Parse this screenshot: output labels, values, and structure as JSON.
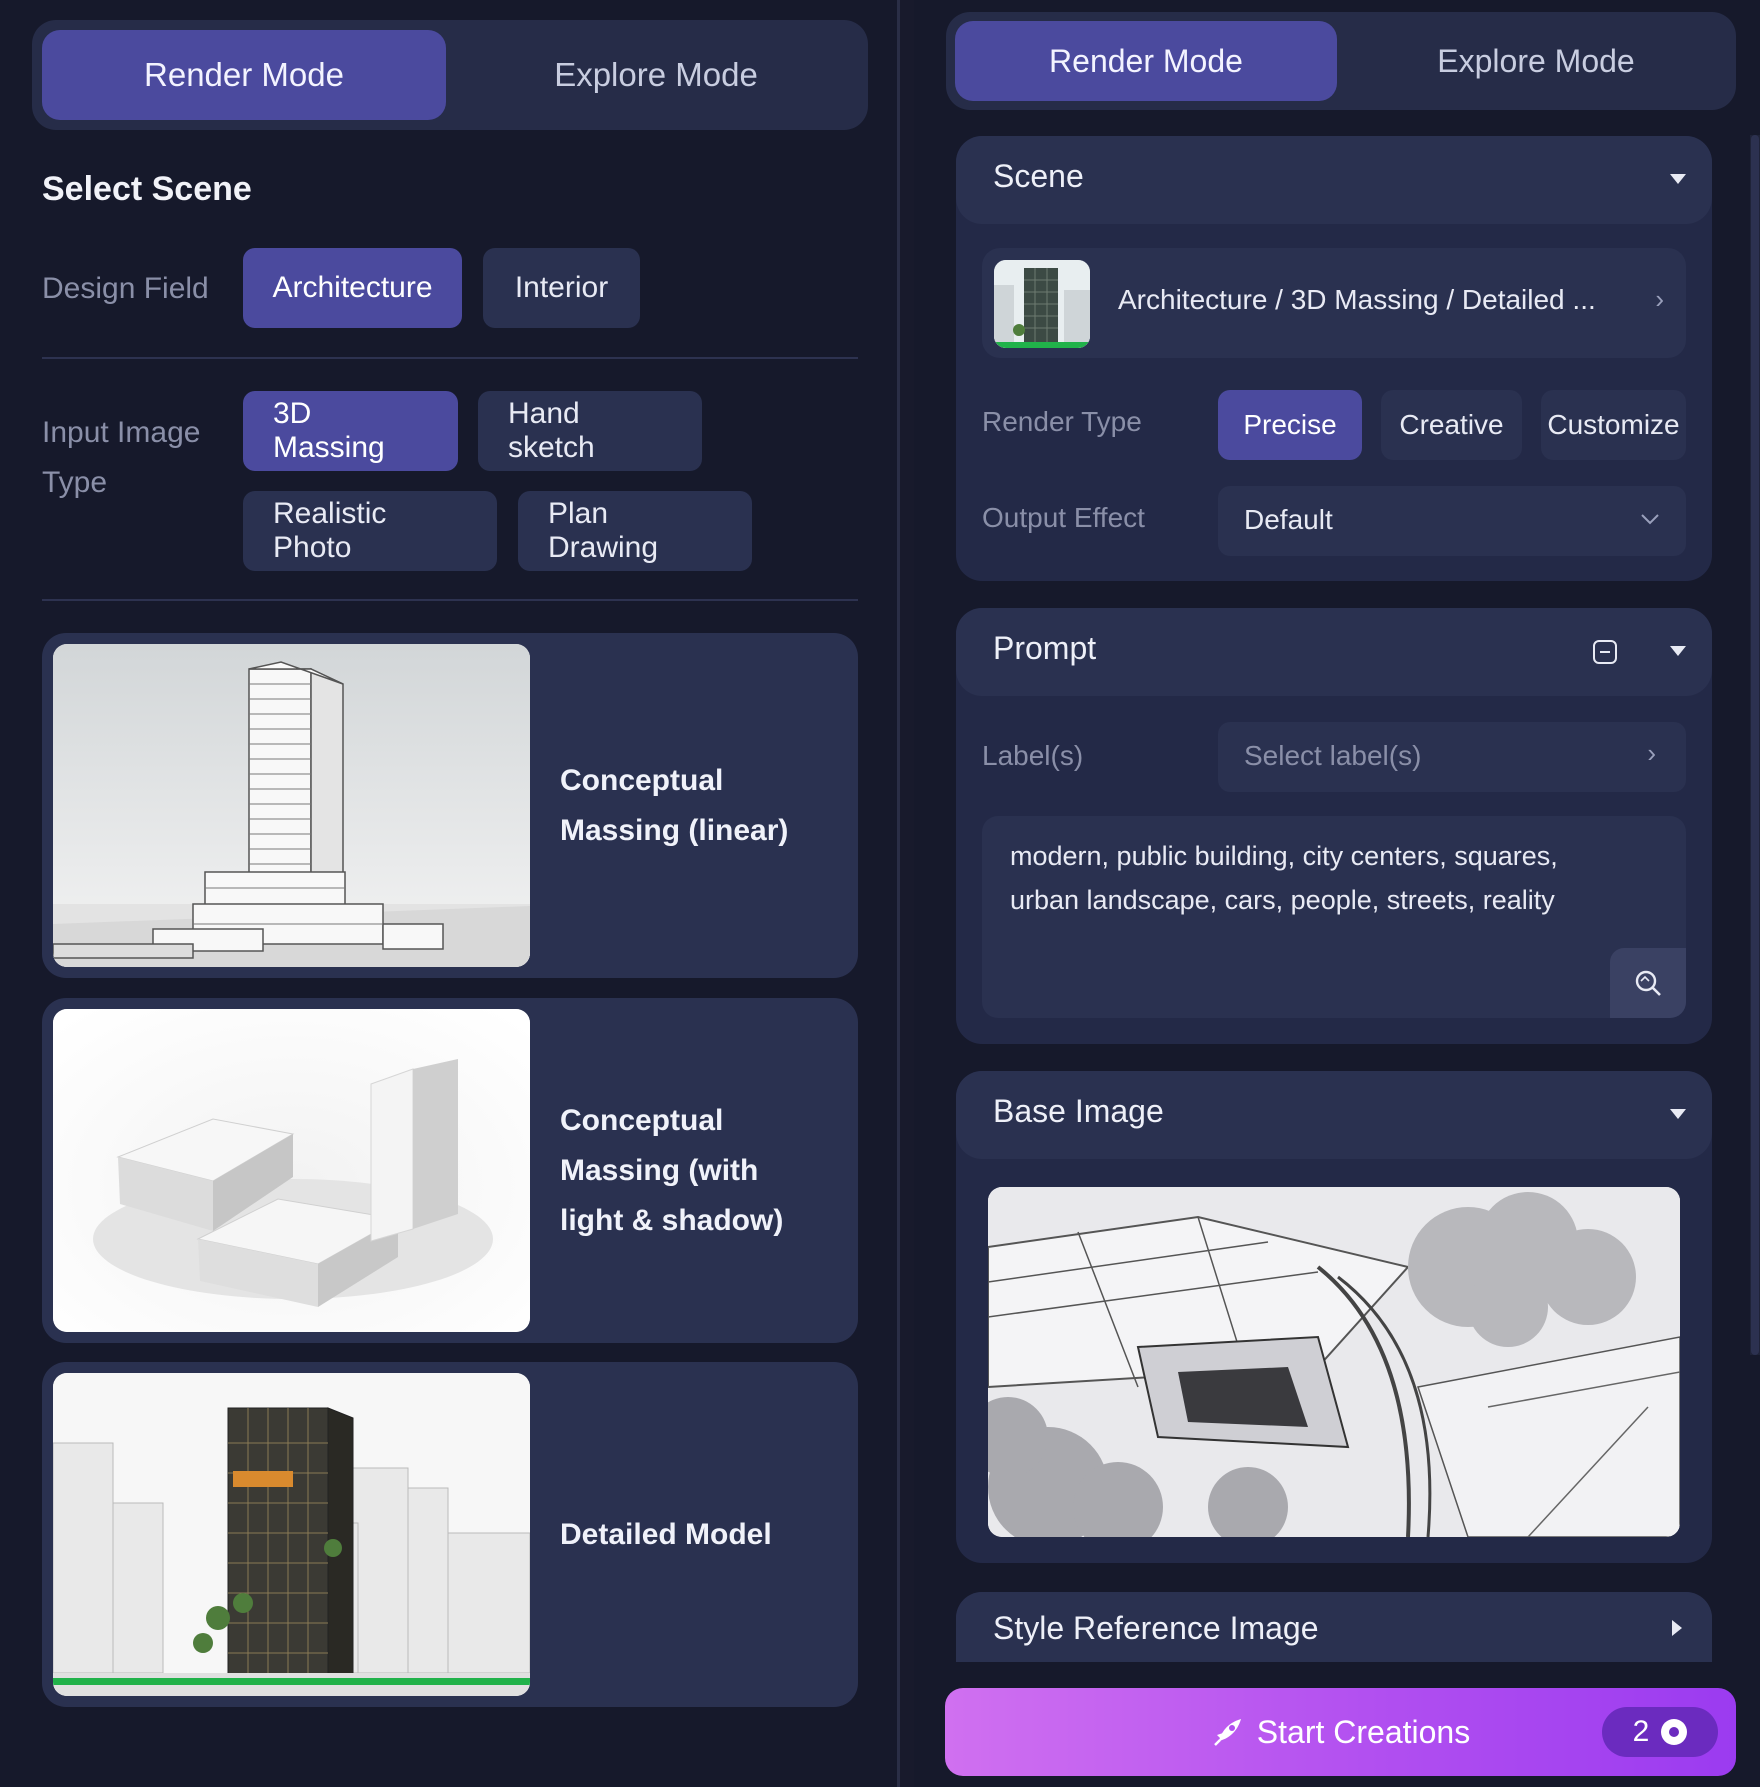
{
  "left": {
    "tabs": [
      {
        "label": "Render Mode",
        "active": true
      },
      {
        "label": "Explore Mode",
        "active": false
      }
    ],
    "section_title": "Select Scene",
    "design_field": {
      "label": "Design Field",
      "options": [
        {
          "label": "Architecture",
          "active": true
        },
        {
          "label": "Interior",
          "active": false
        }
      ]
    },
    "input_type": {
      "label_line1": "Input Image",
      "label_line2": "Type",
      "options": [
        {
          "label": "3D Massing",
          "active": true
        },
        {
          "label": "Hand sketch",
          "active": false
        },
        {
          "label": "Realistic Photo",
          "active": false
        },
        {
          "label": "Plan Drawing",
          "active": false
        }
      ]
    },
    "scenes": [
      {
        "line1": "Conceptual",
        "line2": "Massing (linear)",
        "line3": ""
      },
      {
        "line1": "Conceptual",
        "line2": "Massing (with",
        "line3": "light & shadow)"
      },
      {
        "line1": "Detailed Model",
        "line2": "",
        "line3": ""
      }
    ]
  },
  "right": {
    "tabs": [
      {
        "label": "Render Mode",
        "active": true
      },
      {
        "label": "Explore Mode",
        "active": false
      }
    ],
    "scene": {
      "title": "Scene",
      "path": "Architecture / 3D Massing / Detailed ...",
      "render_type_label": "Render Type",
      "render_types": [
        {
          "label": "Precise",
          "active": true
        },
        {
          "label": "Creative",
          "active": false
        },
        {
          "label": "Customize",
          "active": false
        }
      ],
      "output_effect_label": "Output Effect",
      "output_effect_value": "Default"
    },
    "prompt": {
      "title": "Prompt",
      "labels_label": "Label(s)",
      "labels_placeholder": "Select label(s)",
      "text_line1": "modern, public building, city centers, squares,",
      "text_line2": "urban landscape, cars, people, streets, reality"
    },
    "base_image": {
      "title": "Base Image"
    },
    "style_reference": {
      "title": "Style Reference Image"
    },
    "start": {
      "label": "Start Creations",
      "credits": "2"
    }
  },
  "colors": {
    "background": "#16192b",
    "panel": "#2a3150",
    "accent": "#4b4a9e",
    "start_gradient_start": "#d070f0",
    "start_gradient_end": "#9b3bf0"
  }
}
